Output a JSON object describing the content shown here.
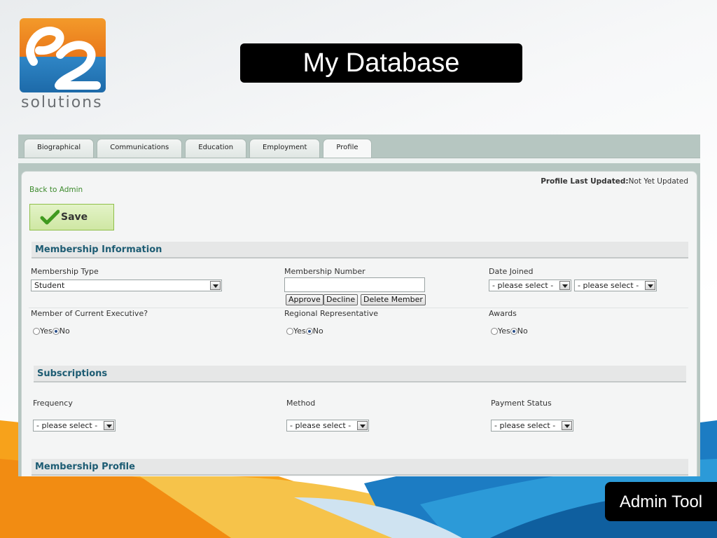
{
  "slide": {
    "title": "My Database",
    "footer_label": "Admin Tool",
    "logo_text": "solutions"
  },
  "tabs": [
    {
      "label": "Biographical",
      "active": false
    },
    {
      "label": "Communications",
      "active": false
    },
    {
      "label": "Education",
      "active": false
    },
    {
      "label": "Employment",
      "active": false
    },
    {
      "label": "Profile",
      "active": true
    }
  ],
  "header": {
    "updated_label": "Profile Last Updated:",
    "updated_value": "Not Yet Updated",
    "back_link": "Back to Admin",
    "save_label": "Save"
  },
  "membership": {
    "section_title": "Membership Information",
    "type_label": "Membership Type",
    "type_value": "Student",
    "number_label": "Membership Number",
    "number_value": "",
    "approve_label": "Approve",
    "decline_label": "Decline",
    "delete_label": "Delete Member",
    "date_label": "Date Joined",
    "date_month": "- please select -",
    "date_year": "- please select -",
    "executive_label": "Member of Current Executive?",
    "regional_label": "Regional Representative",
    "awards_label": "Awards",
    "yes_label": "Yes",
    "no_label": "No"
  },
  "subscriptions": {
    "section_title": "Subscriptions",
    "frequency_label": "Frequency",
    "frequency_value": "- please select -",
    "method_label": "Method",
    "method_value": "- please select -",
    "payment_label": "Payment Status",
    "payment_value": "- please select -"
  },
  "profile": {
    "section_title": "Membership Profile"
  },
  "colors": {
    "section_text": "#1d5c73",
    "link": "#3c8a2c",
    "save_bg": "#d7ecb3"
  }
}
